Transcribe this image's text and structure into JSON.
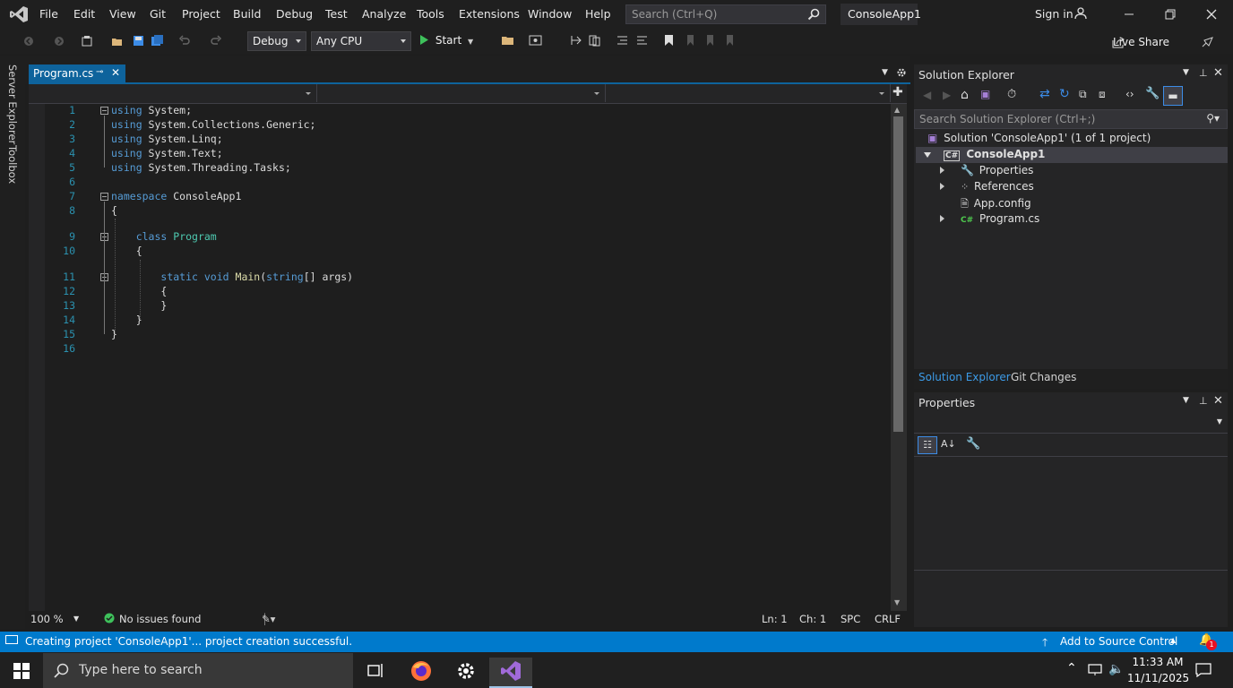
{
  "menu": {
    "items": [
      "File",
      "Edit",
      "View",
      "Git",
      "Project",
      "Build",
      "Debug",
      "Test",
      "Analyze",
      "Tools",
      "Extensions",
      "Window",
      "Help"
    ],
    "search_placeholder": "Search (Ctrl+Q)",
    "solution_title": "ConsoleApp1",
    "sign_in": "Sign in"
  },
  "toolbar": {
    "config": "Debug",
    "platform": "Any CPU",
    "start": "Start",
    "live_share": "Live Share"
  },
  "left_tabs": [
    "Server Explorer",
    "Toolbox"
  ],
  "editor": {
    "tab_label": "Program.cs",
    "zoom": "100 %",
    "issues": "No issues found",
    "ln": "Ln: 1",
    "ch": "Ch: 1",
    "spc": "SPC",
    "crlf": "CRLF",
    "line_numbers": [
      "1",
      "2",
      "3",
      "4",
      "5",
      "6",
      "7",
      "8",
      "9",
      "10",
      "11",
      "12",
      "13",
      "14",
      "15",
      "16"
    ]
  },
  "solution_explorer": {
    "title": "Solution Explorer",
    "search_placeholder": "Search Solution Explorer (Ctrl+;)",
    "solution_label": "Solution 'ConsoleApp1' (1 of 1 project)",
    "project": "ConsoleApp1",
    "items": [
      "Properties",
      "References",
      "App.config",
      "Program.cs"
    ],
    "tab_active": "Solution Explorer",
    "tab_other": "Git Changes"
  },
  "properties": {
    "title": "Properties"
  },
  "status": {
    "message": "Creating project 'ConsoleApp1'... project creation successful.",
    "source_control": "Add to Source Control",
    "notifications": "1"
  },
  "taskbar": {
    "search_placeholder": "Type here to search",
    "time": "11:33 AM",
    "date": "11/11/2025"
  },
  "colors": {
    "accent": "#007acc",
    "keyword": "#569cd6",
    "type": "#4ec9b0",
    "line_number": "#2b91af"
  }
}
